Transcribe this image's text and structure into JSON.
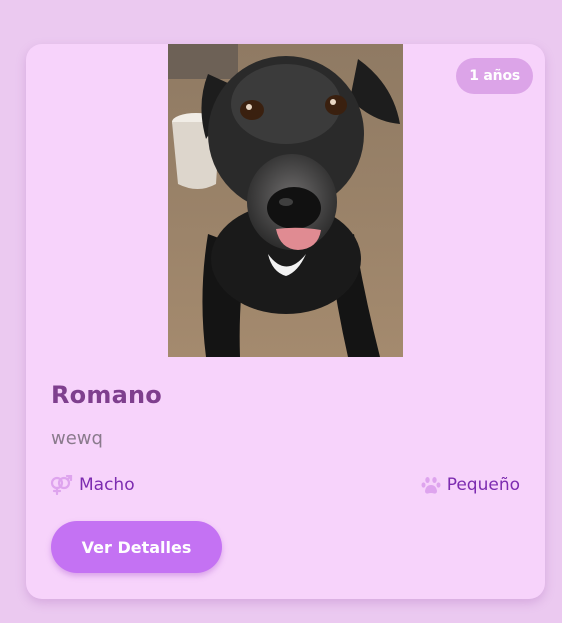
{
  "card": {
    "age_badge": "1 años",
    "name": "Romano",
    "description": "wewq",
    "gender": {
      "label": "Macho",
      "icon": "gender-icon"
    },
    "size": {
      "label": "Pequeño",
      "icon": "paw-icon"
    },
    "details_button": "Ver Detalles"
  },
  "colors": {
    "page_background": "#ebc9f0",
    "card_background": "#f7d3fb",
    "accent": "#c472f3",
    "name_text": "#7f3f8e",
    "meta_text": "#7c2bb0",
    "badge_background": "#dca4e8"
  }
}
